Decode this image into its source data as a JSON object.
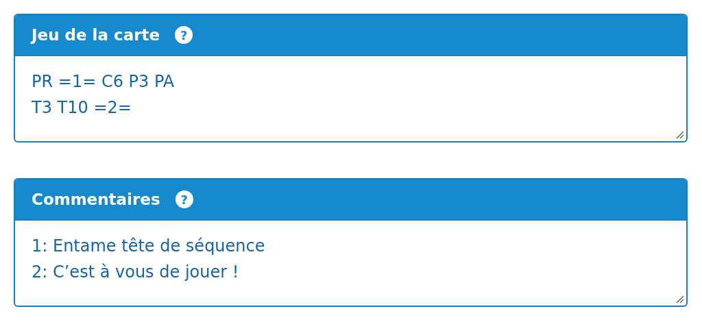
{
  "panels": [
    {
      "title": "Jeu de la carte",
      "help": "?",
      "value": "PR =1= C6 P3 PA\nT3 T10 =2="
    },
    {
      "title": "Commentaires",
      "help": "?",
      "value": "1: Entame tête de séquence\n2: C’est à vous de jouer !"
    }
  ]
}
